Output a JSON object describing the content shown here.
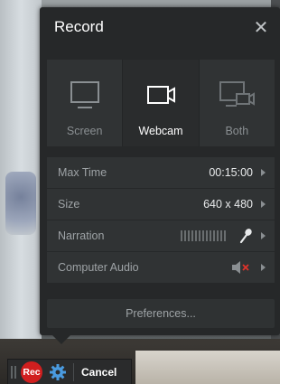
{
  "panel": {
    "title": "Record",
    "close_glyph": "✕"
  },
  "sources": [
    {
      "label": "Screen",
      "icon": "monitor-icon",
      "active": false
    },
    {
      "label": "Webcam",
      "icon": "webcam-icon",
      "active": true
    },
    {
      "label": "Both",
      "icon": "screen-and-webcam-icon",
      "active": false
    }
  ],
  "settings": {
    "max_time": {
      "label": "Max Time",
      "value": "00:15:00"
    },
    "size": {
      "label": "Size",
      "value": "640 x 480"
    },
    "narration": {
      "label": "Narration"
    },
    "computer_audio": {
      "label": "Computer Audio"
    }
  },
  "preferences_label": "Preferences...",
  "toolbar": {
    "rec_label": "Rec",
    "cancel_label": "Cancel"
  },
  "colors": {
    "panel_bg": "#262829",
    "rec_red": "#d11f1f",
    "gear_blue": "#4a9be0",
    "muted_red": "#e0332b"
  }
}
